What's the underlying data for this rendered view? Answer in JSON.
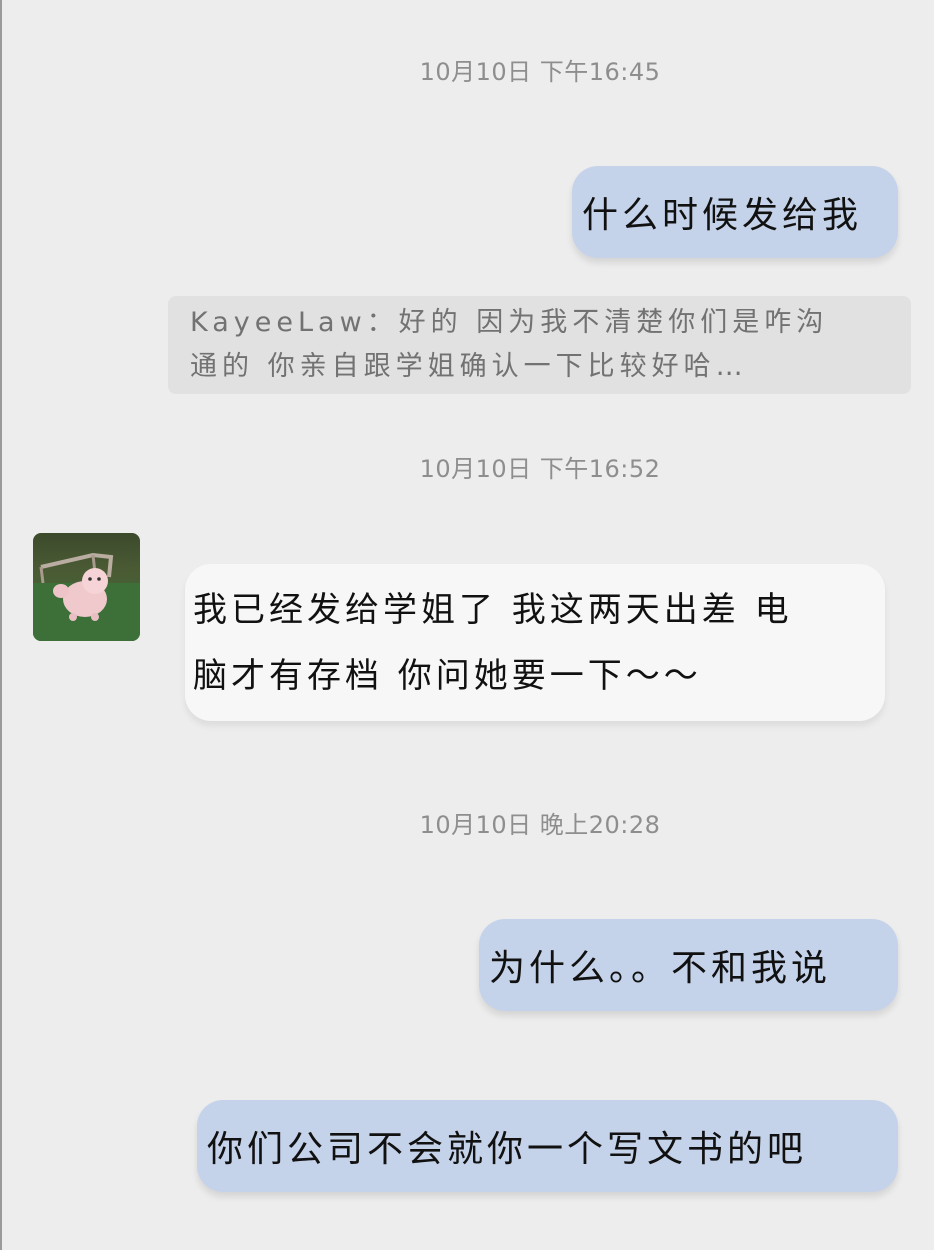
{
  "messages": [
    {
      "type": "timestamp",
      "text": "10月10日 下午16:45"
    },
    {
      "type": "sent",
      "text": "什么时候发给我"
    },
    {
      "type": "quote",
      "line1": "KayeeLaw：好的 因为我不清楚你们是咋沟",
      "line2": "通的 你亲自跟学姐确认一下比较好哈…"
    },
    {
      "type": "timestamp",
      "text": "10月10日 下午16:52"
    },
    {
      "type": "received",
      "line1": "我已经发给学姐了 我这两天出差 电",
      "line2": "脑才有存档 你问她要一下～～"
    },
    {
      "type": "timestamp",
      "text": "10月10日 晚上20:28"
    },
    {
      "type": "sent",
      "text": "为什么。。不和我说"
    },
    {
      "type": "sent",
      "text": "你们公司不会就你一个写文书的吧"
    }
  ],
  "contact": {
    "avatar_icon": "dog-photo-avatar"
  },
  "colors": {
    "background": "#ededed",
    "sent_bubble": "#c5d3ea",
    "received_bubble": "#f7f7f7",
    "quote_box": "#e1e1e1",
    "timestamp_text": "#8e8e8e"
  }
}
